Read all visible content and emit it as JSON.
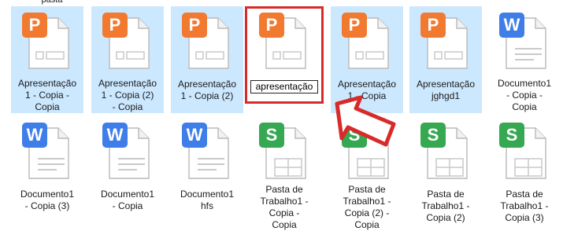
{
  "top_partial_label": "pasta",
  "colors": {
    "selection": "#cce8ff",
    "ppt": "#f27a30",
    "word": "#3f7ee8",
    "excel": "#36a852",
    "highlight": "#d92a2a"
  },
  "row1": [
    {
      "type": "ppt",
      "badge": "P",
      "lines": [
        "Apresentação",
        "1 - Copia -",
        "Copia"
      ],
      "selected": true
    },
    {
      "type": "ppt",
      "badge": "P",
      "lines": [
        "Apresentação",
        "1 - Copia (2)",
        "- Copia"
      ],
      "selected": true
    },
    {
      "type": "ppt",
      "badge": "P",
      "lines": [
        "Apresentação",
        "1 - Copia (2)"
      ],
      "selected": true
    },
    {
      "type": "ppt",
      "badge": "P",
      "rename_value": "apresentação",
      "selected": false
    },
    {
      "type": "ppt",
      "badge": "P",
      "lines": [
        "Apresentação",
        "1 - Copia"
      ],
      "selected": true
    },
    {
      "type": "ppt",
      "badge": "P",
      "lines": [
        "Apresentação",
        "jghgd1"
      ],
      "selected": true
    },
    {
      "type": "word",
      "badge": "W",
      "lines": [
        "Documento1",
        "- Copia -",
        "Copia"
      ],
      "selected": false
    }
  ],
  "row2": [
    {
      "type": "word",
      "badge": "W",
      "lines": [
        "Documento1",
        "- Copia (3)"
      ]
    },
    {
      "type": "word",
      "badge": "W",
      "lines": [
        "Documento1",
        "- Copia"
      ]
    },
    {
      "type": "word",
      "badge": "W",
      "lines": [
        "Documento1",
        "hfs"
      ]
    },
    {
      "type": "xls",
      "badge": "S",
      "lines": [
        "Pasta de",
        "Trabalho1 -",
        "Copia -",
        "Copia"
      ]
    },
    {
      "type": "xls",
      "badge": "S",
      "lines": [
        "Pasta de",
        "Trabalho1 -",
        "Copia (2) -",
        "Copia"
      ]
    },
    {
      "type": "xls",
      "badge": "S",
      "lines": [
        "Pasta de",
        "Trabalho1 -",
        "Copia (2)"
      ]
    },
    {
      "type": "xls",
      "badge": "S",
      "lines": [
        "Pasta de",
        "Trabalho1 -",
        "Copia (3)"
      ]
    }
  ]
}
